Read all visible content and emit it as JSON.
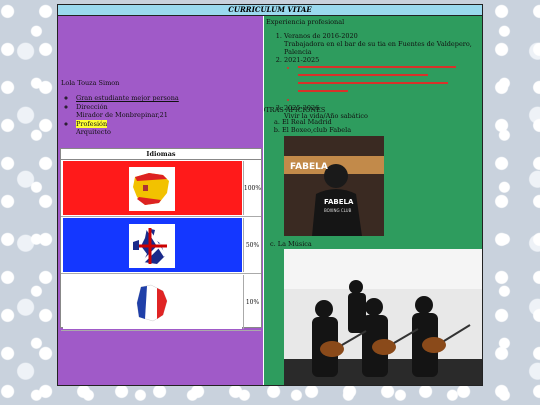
{
  "header": {
    "title": "CURRICULUM VITAE"
  },
  "profile": {
    "name": "Lola Touza Simon",
    "items": [
      {
        "label": "Gran estudiante mejor persona",
        "link": true
      },
      {
        "label": "Dirección",
        "sub": "Mirador de Monbrepinar,21"
      },
      {
        "label": "Profesión",
        "sub": "Arquitecto",
        "highlight": true
      }
    ]
  },
  "languages": {
    "heading": "Idiomas",
    "rows": [
      {
        "flag": "spain-map-flag",
        "pct": "100%",
        "bg": "#ff1a1a"
      },
      {
        "flag": "uk-map-flag",
        "pct": "50%",
        "bg": "#1437ff"
      },
      {
        "flag": "france-map-flag",
        "pct": "10%",
        "bg": "#ffffff"
      }
    ]
  },
  "experience": {
    "title": "Experiencia profesional",
    "jobs": [
      {
        "title": "Veranos de 2016-2020",
        "desc": "Trabajadora en el bar de su tia en Fuentes de Valdepero, Palencia"
      },
      {
        "title": "2021-2025",
        "red": true
      },
      {
        "title": "2025-2026",
        "desc": "Vivir la vida/Año sabático"
      }
    ]
  },
  "hobbies": {
    "title": "OTRAS AFICIONES",
    "items": [
      "El Real Madrid",
      "El Boxeo,club Fabela",
      "La Música"
    ],
    "photo1_text": "FABELA",
    "photo1_sub": "BOXING CLUB"
  },
  "colors": {
    "left": "#a05ac8",
    "right": "#2e9c5e",
    "title": "#9ad9ee"
  }
}
